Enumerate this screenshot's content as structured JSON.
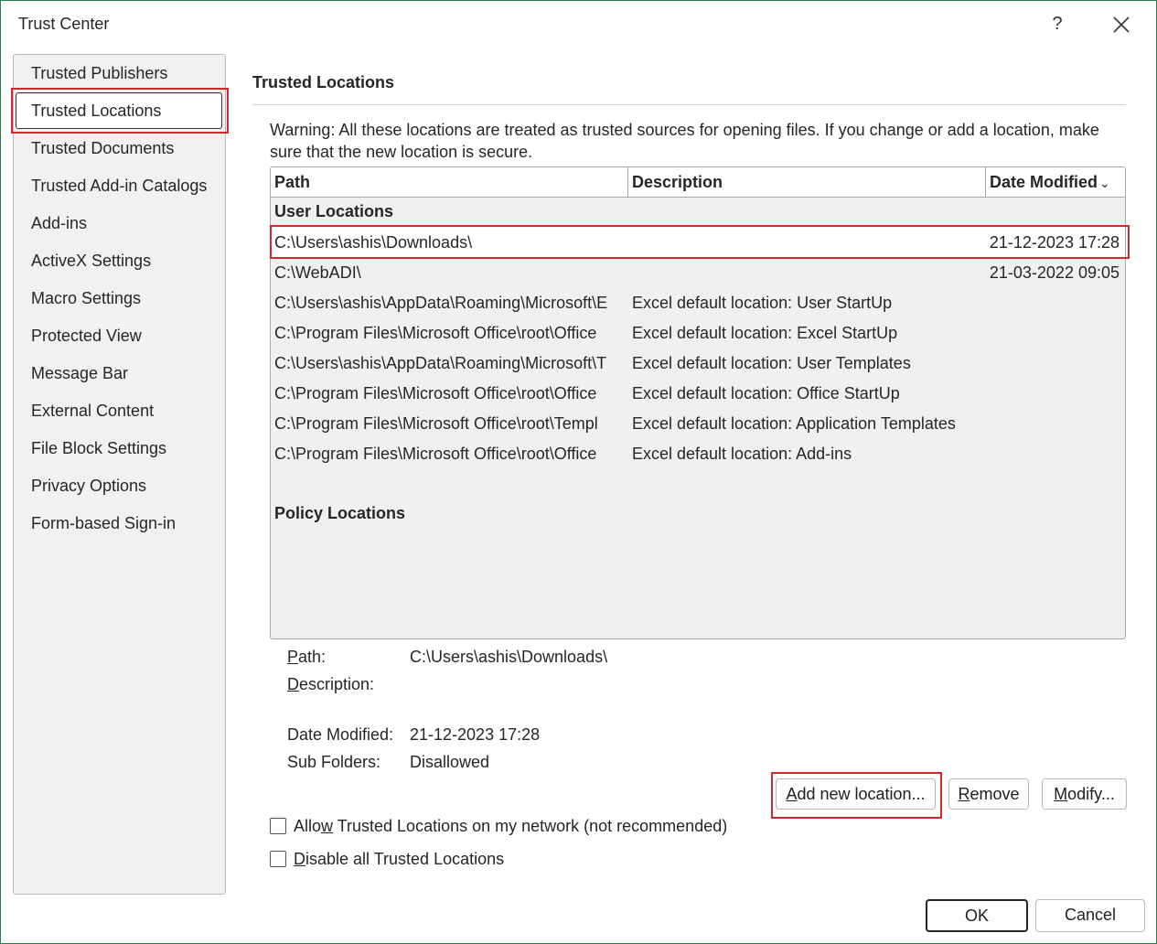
{
  "window": {
    "title": "Trust Center",
    "help": "?"
  },
  "sidebar": {
    "items": [
      {
        "label": "Trusted Publishers"
      },
      {
        "label": "Trusted Locations"
      },
      {
        "label": "Trusted Documents"
      },
      {
        "label": "Trusted Add-in Catalogs"
      },
      {
        "label": "Add-ins"
      },
      {
        "label": "ActiveX Settings"
      },
      {
        "label": "Macro Settings"
      },
      {
        "label": "Protected View"
      },
      {
        "label": "Message Bar"
      },
      {
        "label": "External Content"
      },
      {
        "label": "File Block Settings"
      },
      {
        "label": "Privacy Options"
      },
      {
        "label": "Form-based Sign-in"
      }
    ]
  },
  "main": {
    "title": "Trusted Locations",
    "warning": "Warning: All these locations are treated as trusted sources for opening files.  If you change or add a location, make sure that the new location is secure.",
    "table": {
      "columns": [
        "Path",
        "Description",
        "Date Modified"
      ],
      "sort_indicator": "⌄",
      "user_group": "User Locations",
      "policy_group": "Policy Locations",
      "rows": [
        {
          "path": "C:\\Users\\ashis\\Downloads\\",
          "description": "",
          "date": "21-12-2023 17:28"
        },
        {
          "path": "C:\\WebADI\\",
          "description": "",
          "date": "21-03-2022 09:05"
        },
        {
          "path": "C:\\Users\\ashis\\AppData\\Roaming\\Microsoft\\E",
          "description": "Excel default location: User StartUp",
          "date": ""
        },
        {
          "path": "C:\\Program Files\\Microsoft Office\\root\\Office",
          "description": "Excel default location: Excel StartUp",
          "date": ""
        },
        {
          "path": "C:\\Users\\ashis\\AppData\\Roaming\\Microsoft\\T",
          "description": "Excel default location: User Templates",
          "date": ""
        },
        {
          "path": "C:\\Program Files\\Microsoft Office\\root\\Office",
          "description": "Excel default location: Office StartUp",
          "date": ""
        },
        {
          "path": "C:\\Program Files\\Microsoft Office\\root\\Templ",
          "description": "Excel default location: Application Templates",
          "date": ""
        },
        {
          "path": "C:\\Program Files\\Microsoft Office\\root\\Office",
          "description": "Excel default location: Add-ins",
          "date": ""
        }
      ]
    },
    "details": {
      "path_label_u": "P",
      "path_label_rest": "ath:",
      "path_value": "C:\\Users\\ashis\\Downloads\\",
      "desc_label_u": "D",
      "desc_label_rest": "escription:",
      "date_label": "Date Modified:",
      "date_value": "21-12-2023 17:28",
      "sub_label": "Sub Folders:",
      "sub_value": "Disallowed"
    },
    "buttons": {
      "add_u": "A",
      "add_rest": "dd new location...",
      "remove_u": "R",
      "remove_rest": "emove",
      "modify_u": "M",
      "modify_rest": "odify..."
    },
    "checkboxes": {
      "network_pre": "Allo",
      "network_u": "w",
      "network_rest": " Trusted Locations on my network (not recommended)",
      "disable_u": "D",
      "disable_rest": "isable all Trusted Locations"
    }
  },
  "footer": {
    "ok": "OK",
    "cancel": "Cancel"
  },
  "colors": {
    "highlight_red": "#d3282e",
    "frame_green": "#2e7d4f"
  }
}
